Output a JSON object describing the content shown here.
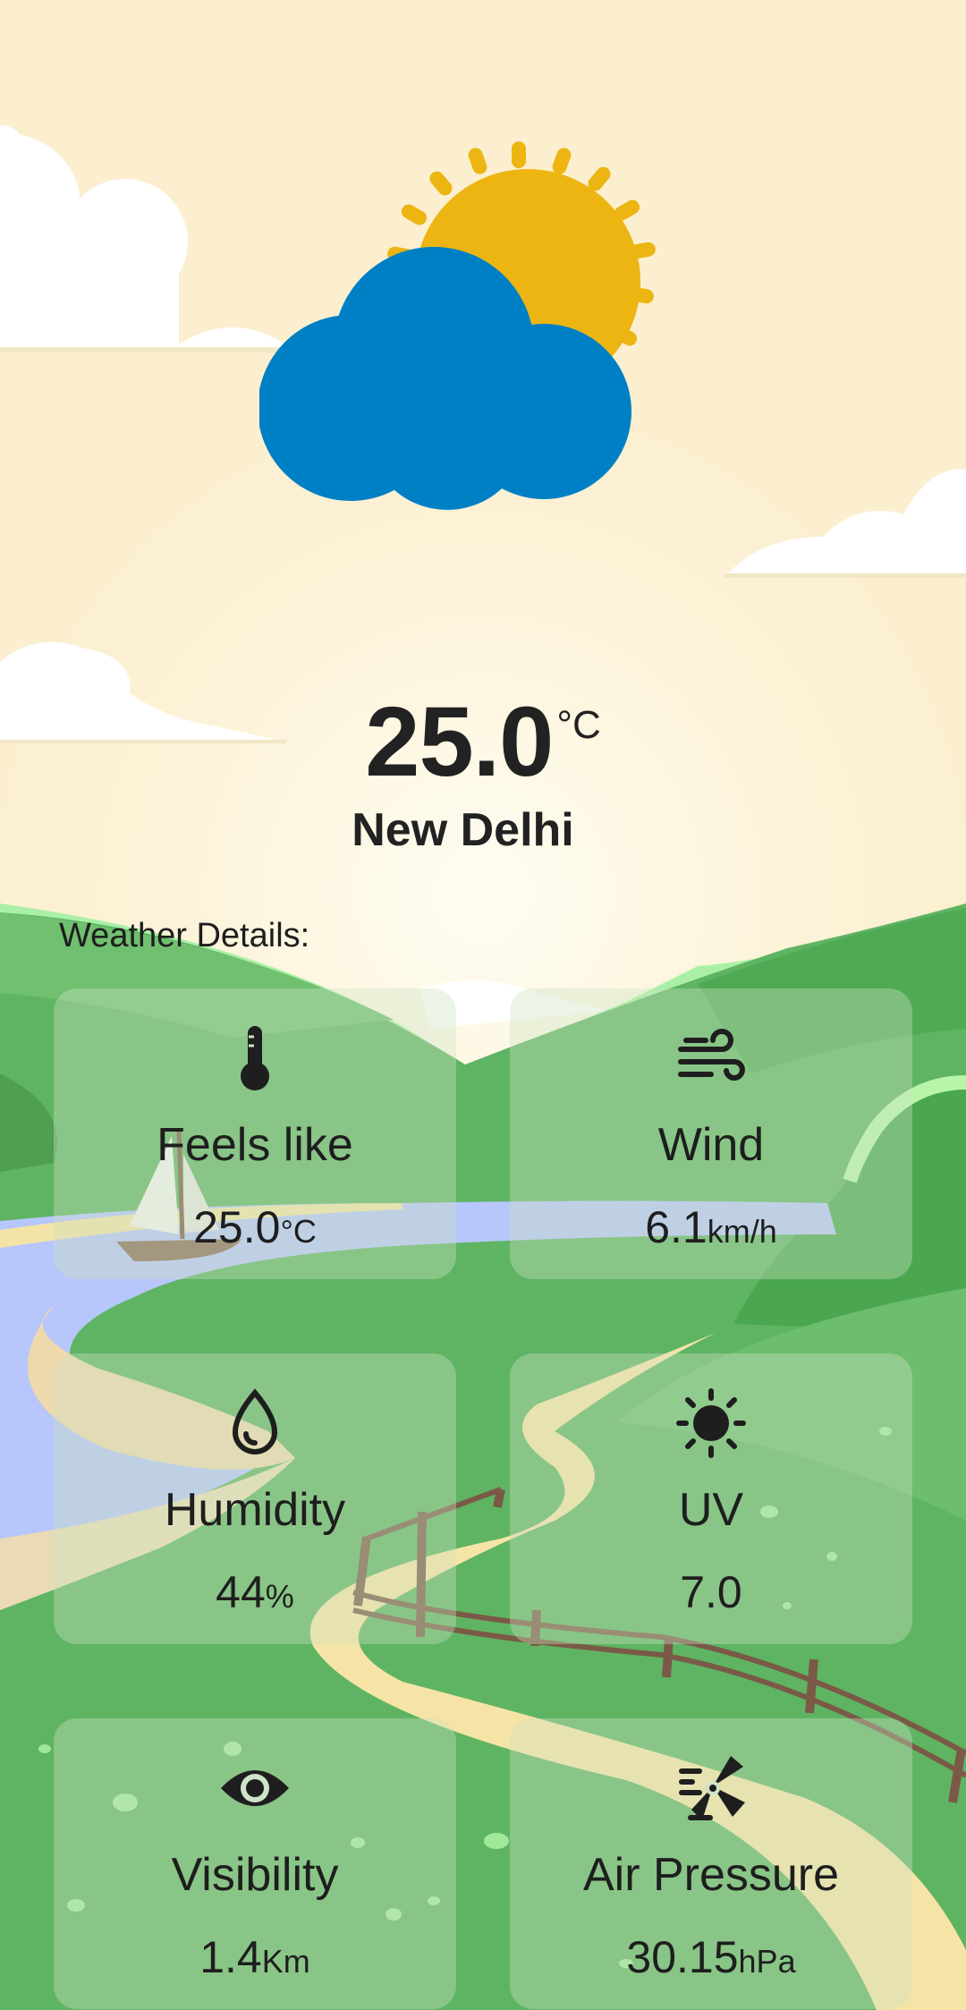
{
  "current": {
    "temperature": "25.0",
    "temperature_unit": "°C",
    "city": "New Delhi",
    "condition_icon": "partly-cloudy-icon"
  },
  "details": {
    "title": "Weather Details:",
    "cards": [
      {
        "label": "Feels like",
        "value": "25.0",
        "unit": "°C",
        "icon": "thermometer-icon"
      },
      {
        "label": "Wind",
        "value": "6.1",
        "unit": "km/h",
        "icon": "wind-icon"
      },
      {
        "label": "Humidity",
        "value": "44",
        "unit": "%",
        "icon": "water-drop-icon"
      },
      {
        "label": "UV",
        "value": "7.0",
        "unit": "",
        "icon": "sun-icon"
      },
      {
        "label": "Visibility",
        "value": "1.4",
        "unit": "Km",
        "icon": "eye-icon"
      },
      {
        "label": "Air Pressure",
        "value": "30.15",
        "unit": "hPa",
        "icon": "air-pressure-icon"
      }
    ]
  },
  "colors": {
    "sky": "#fbf1d6",
    "sun": "#ecb512",
    "cloud": "#0080c4",
    "grass": "#66b86a",
    "river": "#b7c6fb",
    "path": "#f6e4a6"
  }
}
